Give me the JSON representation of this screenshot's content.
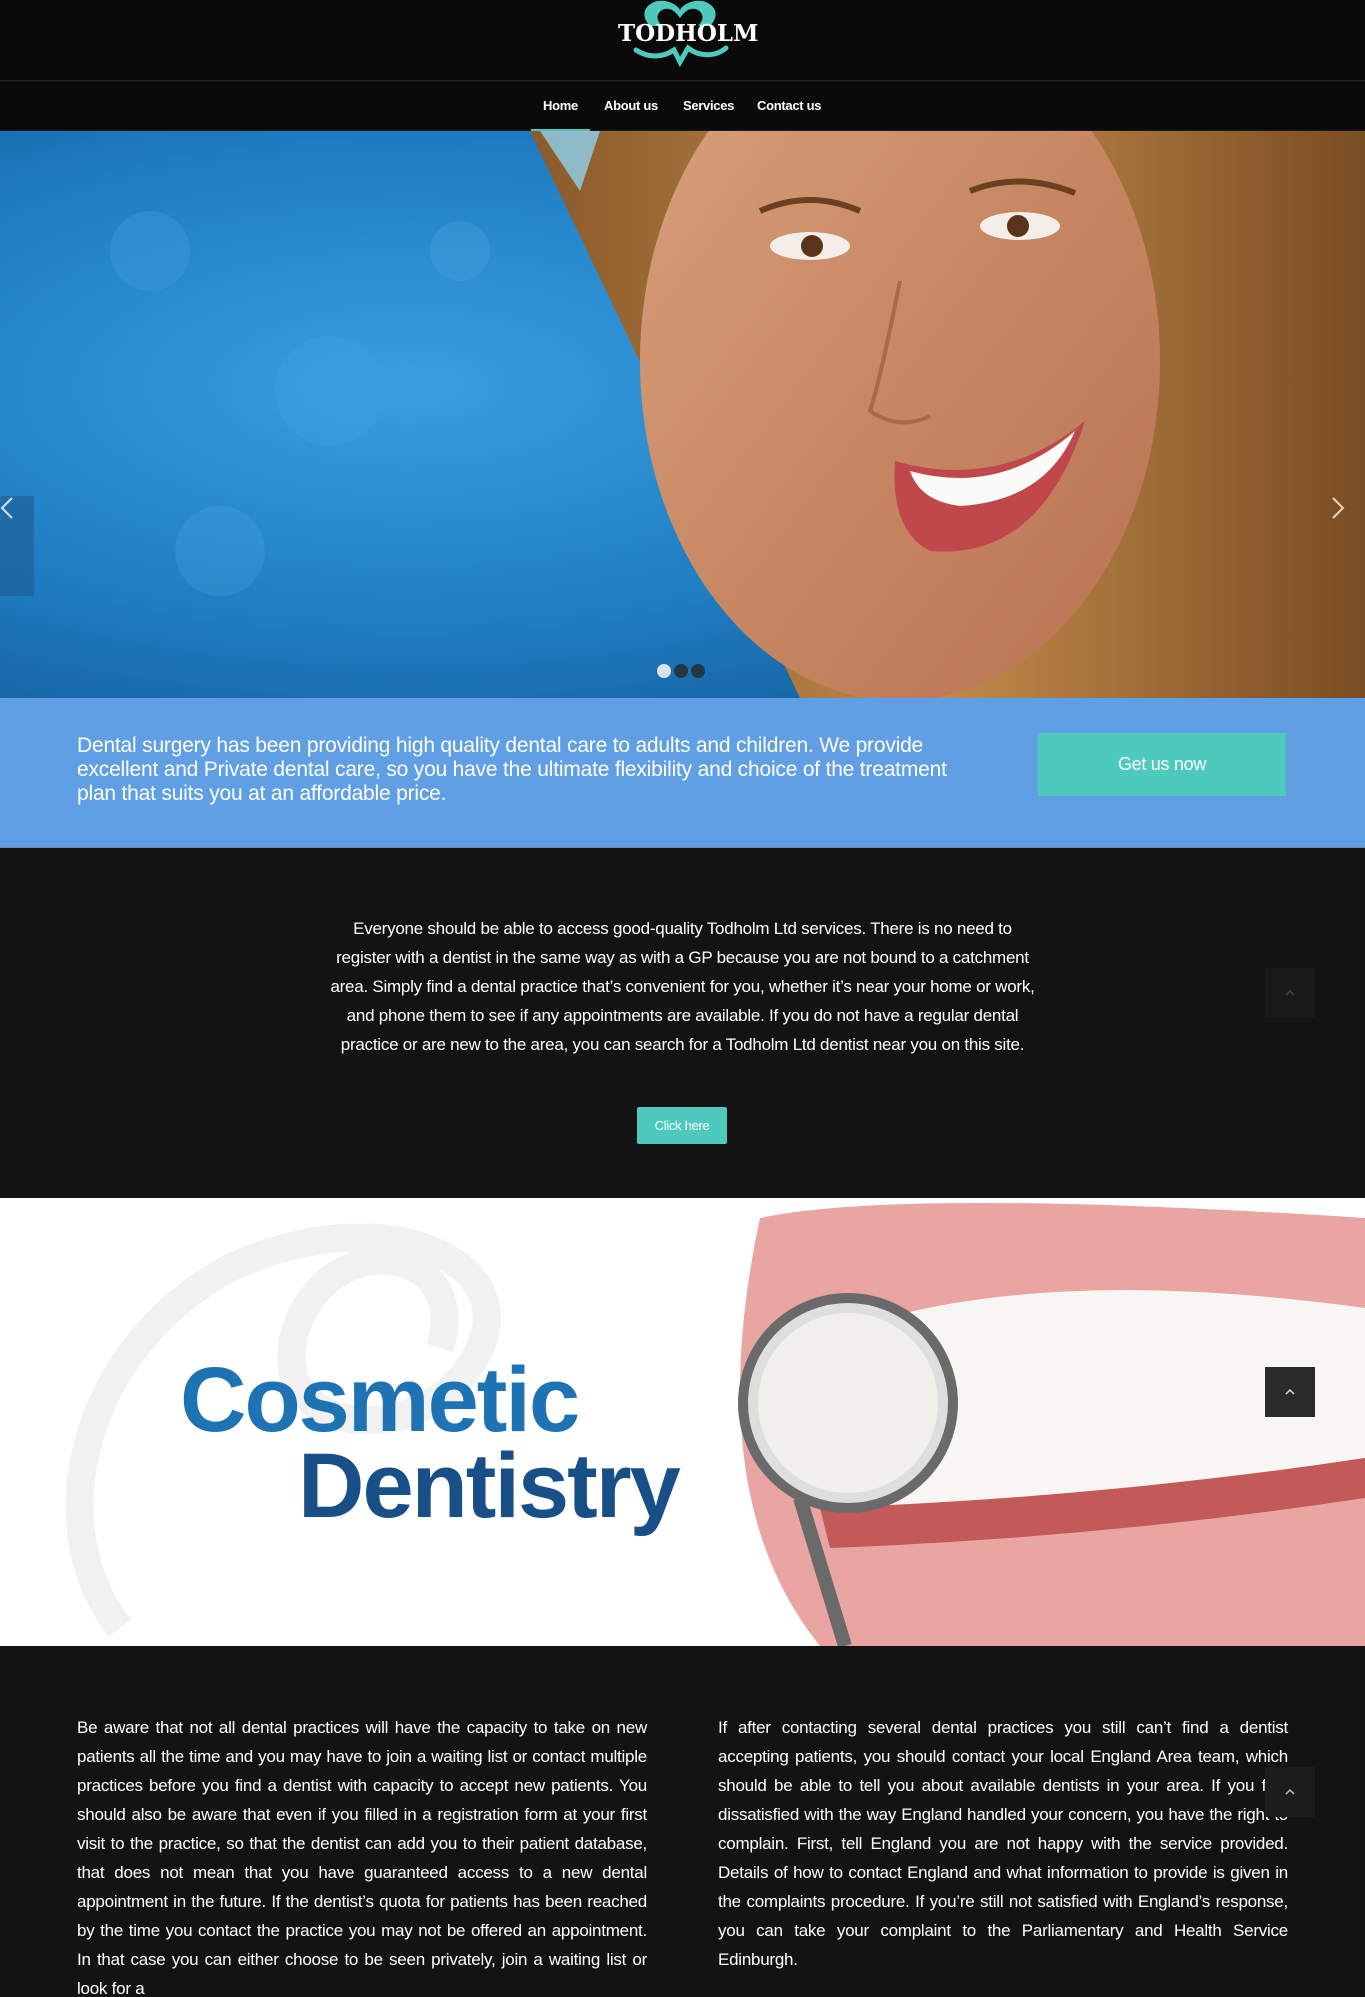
{
  "brand": {
    "logo_text": "TODHOLM"
  },
  "nav": {
    "items": [
      {
        "label": "Home",
        "active": true
      },
      {
        "label": "About us",
        "active": false
      },
      {
        "label": "Services",
        "active": false
      },
      {
        "label": "Contact us",
        "active": false
      }
    ]
  },
  "hero": {
    "slide_count": 3,
    "active_slide": 1
  },
  "callout": {
    "text": "Dental surgery has been providing high quality dental care to adults and children. We provide excellent and Private dental care, so you have the ultimate flexibility and choice of the treatment plan that suits you at an affordable price.",
    "button_label": "Get us now"
  },
  "info": {
    "text": "Everyone should be able to access good-quality Todholm Ltd services. There is no need to register with a dentist in the same way as with a GP because you are not bound to a catchment area. Simply find a dental practice that’s convenient for you, whether it’s near your home or work, and phone them to see if any appointments are available. If you do not have a regular dental practice or are new to the area, you can search for a Todholm Ltd dentist near you on this site.",
    "button_label": "Click here"
  },
  "cosmetic": {
    "line1": "Cosmetic",
    "line2": "Dentistry"
  },
  "columns": {
    "left": "Be aware that not all dental practices will have the capacity to take on new patients all the time and you may have to join a waiting list or contact multiple practices before you find a dentist with capacity to accept new patients. You should also be aware that even if you filled in a registration form at your first visit to the practice, so that the dentist can add you to their patient database, that does not mean that you have guaranteed access to a new dental appointment in the future. If the dentist’s quota for patients has been reached by the time you contact the practice you may not be offered an appointment. In that case you can either choose to be seen privately, join a waiting list or look for a",
    "right": "If after contacting several dental practices you still can’t find a dentist accepting patients, you should contact your local England Area team, which should be able to tell you about available dentists in your area. If you feel dissatisfied with the way England handled your concern, you have the right to complain. First, tell England you are not happy with the service provided. Details of how to contact England and what information to provide is given in the complaints procedure. If you’re still not satisfied with England’s response, you can take your complaint to the Parliamentary and Health Service Edinburgh."
  },
  "colors": {
    "accent": "#4ec9bd",
    "callout_bg": "#609fe4",
    "dark_bg": "#131313",
    "header_bg": "#0a0a0a"
  }
}
